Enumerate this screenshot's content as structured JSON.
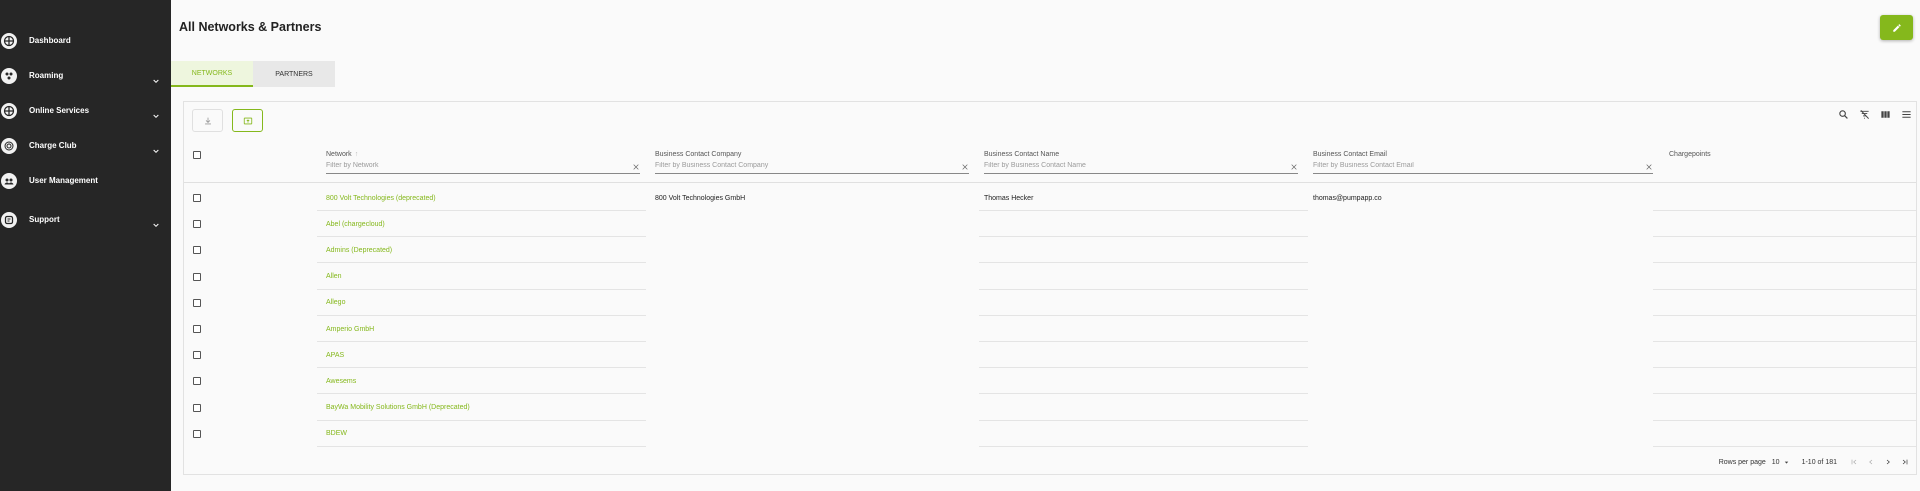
{
  "sidebar": {
    "items": [
      {
        "label": "Dashboard",
        "icon": "dashboard-icon",
        "expandable": false
      },
      {
        "label": "Roaming",
        "icon": "roaming-icon",
        "expandable": true
      },
      {
        "label": "Online Services",
        "icon": "online-services-icon",
        "expandable": true
      },
      {
        "label": "Charge Club",
        "icon": "charge-club-icon",
        "expandable": true
      },
      {
        "label": "User Management",
        "icon": "users-icon",
        "expandable": false
      },
      {
        "label": "Support",
        "icon": "support-icon",
        "expandable": true
      }
    ]
  },
  "page": {
    "title": "All Networks & Partners",
    "edit_icon": "pencil-icon"
  },
  "tabs": [
    {
      "label": "NETWORKS",
      "active": true
    },
    {
      "label": "PARTNERS",
      "active": false
    }
  ],
  "table": {
    "columns": [
      {
        "label": "Network",
        "filter_placeholder": "Filter by Network",
        "sortable": true
      },
      {
        "label": "Business Contact Company",
        "filter_placeholder": "Filter by Business Contact Company"
      },
      {
        "label": "Business Contact Name",
        "filter_placeholder": "Filter by Business Contact Name"
      },
      {
        "label": "Business Contact Email",
        "filter_placeholder": "Filter by Business Contact Email"
      },
      {
        "label": "Chargepoints"
      }
    ],
    "rows": [
      {
        "network": "800 Volt Technologies (deprecated)",
        "company": "800 Volt Technologies GmbH",
        "name": "Thomas Hecker",
        "email": "thomas@pumpapp.co",
        "chargepoints": ""
      },
      {
        "network": "Abel (chargecloud)",
        "company": "",
        "name": "",
        "email": "",
        "chargepoints": ""
      },
      {
        "network": "Admins (Deprecated)",
        "company": "",
        "name": "",
        "email": "",
        "chargepoints": ""
      },
      {
        "network": "Allen",
        "company": "",
        "name": "",
        "email": "",
        "chargepoints": ""
      },
      {
        "network": "Allego",
        "company": "",
        "name": "",
        "email": "",
        "chargepoints": ""
      },
      {
        "network": "Amperio GmbH",
        "company": "",
        "name": "",
        "email": "",
        "chargepoints": ""
      },
      {
        "network": "APAS",
        "company": "",
        "name": "",
        "email": "",
        "chargepoints": ""
      },
      {
        "network": "Awesems",
        "company": "",
        "name": "",
        "email": "",
        "chargepoints": ""
      },
      {
        "network": "BayWa Mobility Solutions GmbH (Deprecated)",
        "company": "",
        "name": "",
        "email": "",
        "chargepoints": ""
      },
      {
        "network": "BDEW",
        "company": "",
        "name": "",
        "email": "",
        "chargepoints": ""
      }
    ]
  },
  "pagination": {
    "rows_per_page_label": "Rows per page",
    "rows_per_page_value": "10",
    "range_label": "1-10 of 181"
  },
  "colors": {
    "accent": "#85b81c",
    "sidebar_bg": "#262626"
  }
}
